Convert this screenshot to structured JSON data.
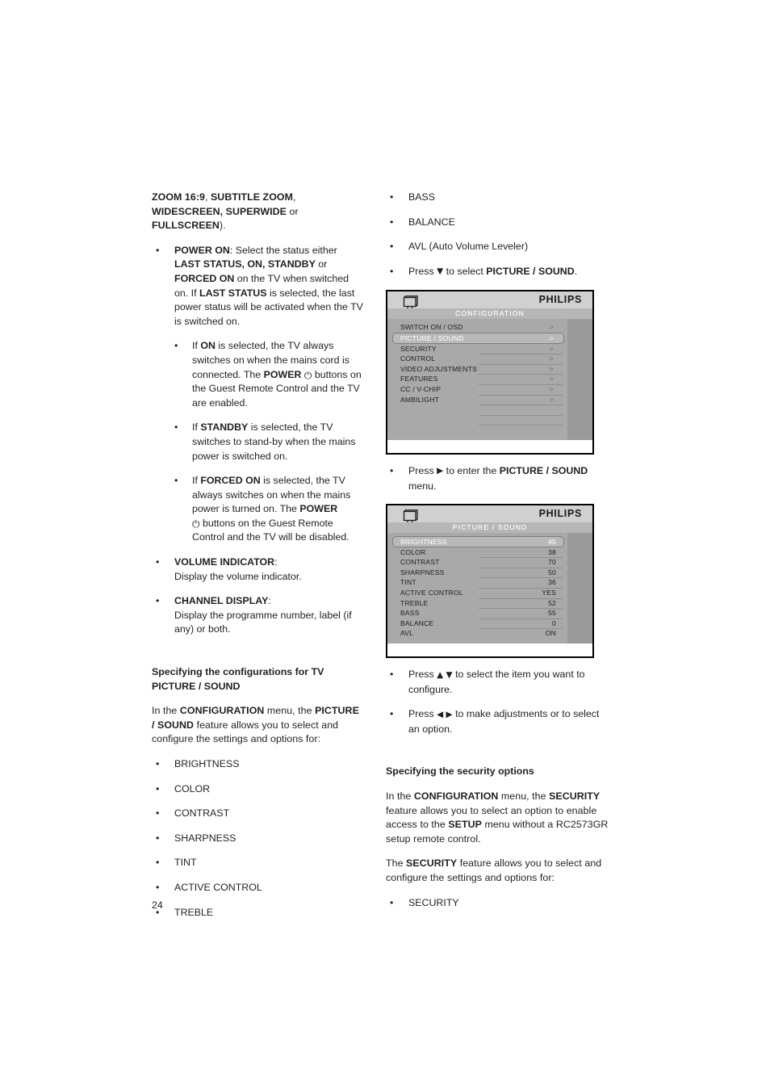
{
  "page": {
    "number": "24"
  },
  "left_column": {
    "intro_continuation": {
      "parts": [
        {
          "t": "ZOOM 16:9",
          "b": true
        },
        {
          "t": ", ",
          "b": false
        },
        {
          "t": "SUBTITLE ZOOM",
          "b": true
        },
        {
          "t": ", ",
          "b": false
        },
        {
          "t": "WIDESCREEN, SUPERWIDE",
          "b": true
        },
        {
          "t": " or ",
          "b": false
        },
        {
          "t": "FULLSCREEN",
          "b": true
        },
        {
          "t": ").",
          "b": false
        }
      ]
    },
    "power_on": {
      "term": "POWER ON",
      "text_1": ": Select the status either ",
      "term_2": "LAST STATUS, ON, STANDBY",
      "text_2": " or ",
      "term_3": "FORCED ON",
      "text_3": " on the TV when switched on. If ",
      "term_4": "LAST STATUS",
      "text_4": " is selected, the last power status will be activated when the TV is switched on."
    },
    "sub_on": {
      "pre": "If ",
      "term": "ON",
      "mid": " is selected, the TV always switches on when the mains cord is connected. The ",
      "term_2": "POWER",
      "icon": "power-icon",
      "post": " buttons on the Guest Remote Control and the TV are enabled."
    },
    "sub_standby": {
      "pre": "If ",
      "term": "STANDBY",
      "post": " is selected, the TV switches to stand-by when the mains power is switched on."
    },
    "sub_forced_on": {
      "pre": "If ",
      "term": "FORCED ON",
      "mid": " is selected, the TV always switches on when the mains power is turned on. The ",
      "term_2": "POWER",
      "icon": "power-icon",
      "post": " buttons on the Guest Remote Control and the TV will be disabled."
    },
    "volume_indicator": {
      "term": "VOLUME INDICATOR",
      "colon": ":",
      "desc": "Display the volume indicator."
    },
    "channel_display": {
      "term": "CHANNEL DISPLAY",
      "colon": ":",
      "desc": "Display the programme number, label (if any) or both."
    },
    "section_heading": "Specifying the configurations for TV PICTURE / SOUND",
    "section_intro": {
      "a": "In the ",
      "term_1": "CONFIGURATION",
      "b": " menu, the ",
      "term_2": "PICTURE / SOUND",
      "c": " feature allows you to select and configure the settings and options for:"
    },
    "options": [
      "BRIGHTNESS",
      "COLOR",
      "CONTRAST",
      "SHARPNESS",
      "TINT",
      "ACTIVE CONTROL",
      "TREBLE"
    ]
  },
  "right_column": {
    "options_continued": [
      "BASS",
      "BALANCE",
      "AVL (Auto Volume Leveler)"
    ],
    "press_down": {
      "a": "Press ",
      "arrow": "▼",
      "b": " to select ",
      "term": "PICTURE / SOUND",
      "c": "."
    },
    "press_right": {
      "a": "Press ",
      "arrow": "▶",
      "b": " to enter the ",
      "term": "PICTURE / SOUND",
      "c": " menu."
    },
    "press_updown": {
      "a": "Press ",
      "arrow": "▲ ▼",
      "b": " to select the item you want to configure."
    },
    "press_leftright": {
      "a": "Press ",
      "arrow": "◀ ▶",
      "b": " to make adjustments or to select an option."
    },
    "security_heading": "Specifying the security options",
    "security_intro": {
      "a": "In the ",
      "term_1": "CONFIGURATION",
      "b": " menu, the ",
      "term_2": "SECURITY",
      "c": " feature allows you to select an option to enable access to the ",
      "term_3": "SETUP",
      "d": " menu without a RC2573GR setup remote control."
    },
    "security_body": {
      "a": "The ",
      "term_1": "SECURITY",
      "b": " feature allows you to select and configure the settings and options for:"
    },
    "security_options": [
      "SECURITY"
    ]
  },
  "osd_configuration": {
    "brand": "PHILIPS",
    "title": "CONFIGURATION",
    "tv_icon": "tv-monitor-icon",
    "chevron": ">",
    "rows": [
      {
        "label": "SWITCH ON / OSD",
        "chevron": ">",
        "selected": false,
        "sep": false
      },
      {
        "label": "PICTURE  /  SOUND",
        "chevron": ">",
        "selected": true,
        "sep": false
      },
      {
        "label": "SECURITY",
        "chevron": ">",
        "selected": false,
        "sep": false
      },
      {
        "label": "CONTROL",
        "chevron": ">",
        "selected": false,
        "sep": true
      },
      {
        "label": "VIDEO ADJUSTMENTS",
        "chevron": ">",
        "selected": false,
        "sep": true
      },
      {
        "label": "FEATURES",
        "chevron": ">",
        "selected": false,
        "sep": true
      },
      {
        "label": "CC / V-CHIP",
        "chevron": ">",
        "selected": false,
        "sep": true
      },
      {
        "label": "AMBILIGHT",
        "chevron": ">",
        "selected": false,
        "sep": true
      },
      {
        "label": "",
        "chevron": "",
        "selected": false,
        "sep": true
      },
      {
        "label": "",
        "chevron": "",
        "selected": false,
        "sep": true
      },
      {
        "label": "",
        "chevron": "",
        "selected": false,
        "sep": true
      }
    ]
  },
  "osd_picture_sound": {
    "brand": "PHILIPS",
    "title": "PICTURE  /  SOUND",
    "tv_icon": "tv-monitor-icon",
    "rows": [
      {
        "label": "BRIGHTNESS",
        "value": "45",
        "selected": true,
        "sep": false
      },
      {
        "label": "COLOR",
        "value": "38",
        "selected": false,
        "sep": false
      },
      {
        "label": "CONTRAST",
        "value": "70",
        "selected": false,
        "sep": true
      },
      {
        "label": "SHARPNESS",
        "value": "50",
        "selected": false,
        "sep": true
      },
      {
        "label": "TINT",
        "value": "36",
        "selected": false,
        "sep": true
      },
      {
        "label": "ACTIVE CONTROL",
        "value": "YES",
        "selected": false,
        "sep": true
      },
      {
        "label": "TREBLE",
        "value": "52",
        "selected": false,
        "sep": true
      },
      {
        "label": "BASS",
        "value": "55",
        "selected": false,
        "sep": true
      },
      {
        "label": "BALANCE",
        "value": "0",
        "selected": false,
        "sep": true
      },
      {
        "label": "AVL",
        "value": "ON",
        "selected": false,
        "sep": true
      }
    ]
  },
  "colors": {
    "text": "#231f20",
    "osd_header_bg": "#d0d0d0",
    "osd_title_bg": "#b6b6b6",
    "osd_body_bg": "#a9a9a9",
    "osd_selected_bg": "#b9b9b9",
    "osd_strip_bg": "#9a9a9a",
    "osd_border": "#000000"
  }
}
